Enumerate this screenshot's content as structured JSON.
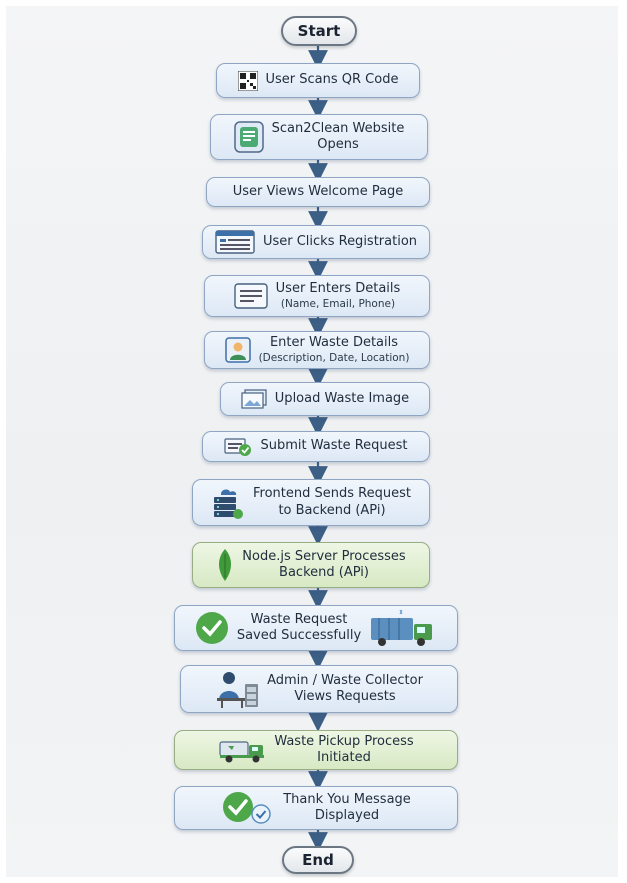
{
  "diagram": {
    "start_label": "Start",
    "end_label": "End",
    "steps": [
      {
        "title": "User Scans QR Code",
        "icon": "qr-code-icon"
      },
      {
        "title": "Scan2Clean Website",
        "title2": "Opens",
        "icon": "website-phone-icon"
      },
      {
        "title": "User Views Welcome Page"
      },
      {
        "title": "User Clicks Registration",
        "icon": "registration-form-icon"
      },
      {
        "title": "User Enters Details",
        "detail": "(Name, Email, Phone)",
        "icon": "details-form-icon"
      },
      {
        "title": "Enter Waste Details",
        "detail": "(Description, Date, Location)",
        "icon": "user-profile-icon"
      },
      {
        "title": "Upload Waste Image",
        "icon": "image-upload-icon"
      },
      {
        "title": "Submit Waste Request",
        "icon": "submit-check-icon"
      },
      {
        "title": "Frontend Sends Request",
        "title2": "to Backend (APi)",
        "icon": "server-cloud-icon"
      },
      {
        "title": "Node.js Server Processes",
        "title2": "Backend (APi)",
        "icon": "nodejs-leaf-icon"
      },
      {
        "title": "Waste Request",
        "title2": "Saved Successfully",
        "icon": "success-check-icon"
      },
      {
        "title": "Admin / Waste Collector",
        "title2": "Views Requests",
        "icon": "admin-desk-icon"
      },
      {
        "title": "Waste Pickup Process",
        "title2": "Initiated",
        "icon": "pickup-truck-icon"
      },
      {
        "title": "Thank You Message",
        "title2": "Displayed",
        "icon": "thank-you-check-icon"
      }
    ],
    "colors": {
      "box_fill": "#dde8f5",
      "box_border": "#8ea6c4",
      "green_box_fill": "#d7e9c4",
      "arrow": "#3c5f86",
      "success_green": "#4ea84a"
    }
  }
}
